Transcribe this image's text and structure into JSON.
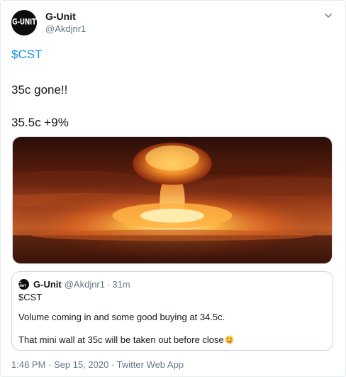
{
  "tweet": {
    "author": {
      "display_name": "G-Unit",
      "handle": "@Akdjnr1",
      "avatar_text": "G-UNIT"
    },
    "lines": {
      "cashtag": "$CST",
      "line2": "35c gone!!",
      "line3": "35.5c +9%"
    },
    "media_icon": "mushroom-cloud-explosion-photo",
    "timestamp": "1:46 PM · Sep 15, 2020",
    "separator": " · ",
    "source": "Twitter Web App",
    "menu_icon": "chevron-down-icon"
  },
  "quoted_tweet": {
    "display_name": "G-Unit",
    "handle": "@Akdjnr1",
    "separator": "·",
    "time": "31m",
    "avatar_text": "G-UNIT",
    "line1": "$CST",
    "line2": "Volume coming in and some good buying at 34.5c.",
    "line3": "That mini wall at 35c will be taken out before close",
    "emoji_icon": "winking-tongue-face-emoji"
  },
  "colors": {
    "link": "#1b95e0",
    "text": "#14171a",
    "secondary": "#657786",
    "border": "#ccd6dd"
  }
}
